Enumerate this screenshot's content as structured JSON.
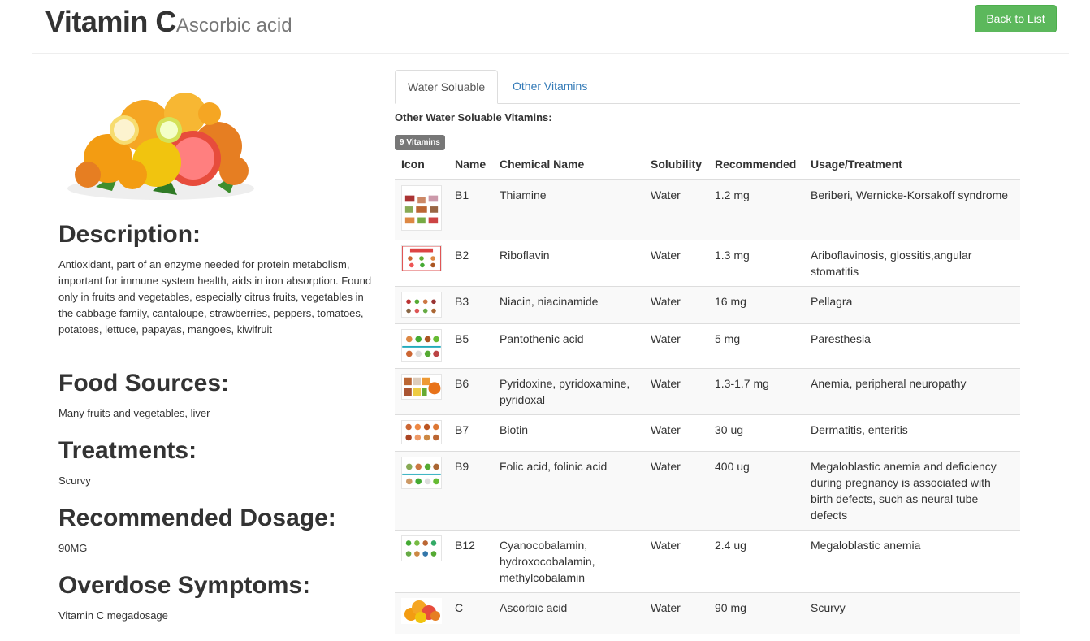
{
  "header": {
    "title": "Vitamin C",
    "subtitle": "Ascorbic acid",
    "back_label": "Back to List"
  },
  "left": {
    "description_heading": "Description:",
    "description": "Antioxidant, part of an enzyme needed for protein metabolism, important for immune system health, aids in iron absorption. Found only in fruits and vegetables, especially citrus fruits, vegetables in the cabbage family, cantaloupe, strawberries, peppers, tomatoes, potatoes, lettuce, papayas, mangoes, kiwifruit",
    "food_heading": "Food Sources:",
    "food": "Many fruits and vegetables, liver",
    "treatments_heading": "Treatments:",
    "treatments": "Scurvy",
    "dosage_heading": "Recommended Dosage:",
    "dosage": "90MG",
    "overdose_heading": "Overdose Symptoms:",
    "overdose": "Vitamin C megadosage"
  },
  "tabs": [
    "Water Soluable",
    "Other Vitamins"
  ],
  "table": {
    "subheading": "Other Water Soluable Vitamins:",
    "badge": "9 Vitamins",
    "headers": [
      "Icon",
      "Name",
      "Chemical Name",
      "Solubility",
      "Recommended",
      "Usage/Treatment"
    ],
    "rows": [
      {
        "name": "B1",
        "chemical": "Thiamine",
        "solubility": "Water",
        "recommended": "1.2 mg",
        "usage": "Beriberi, Wernicke-Korsakoff syndrome"
      },
      {
        "name": "B2",
        "chemical": "Riboflavin",
        "solubility": "Water",
        "recommended": "1.3 mg",
        "usage": "Ariboflavinosis, glossitis,angular stomatitis"
      },
      {
        "name": "B3",
        "chemical": "Niacin, niacinamide",
        "solubility": "Water",
        "recommended": "16 mg",
        "usage": "Pellagra"
      },
      {
        "name": "B5",
        "chemical": "Pantothenic acid",
        "solubility": "Water",
        "recommended": "5 mg",
        "usage": "Paresthesia"
      },
      {
        "name": "B6",
        "chemical": "Pyridoxine, pyridoxamine, pyridoxal",
        "solubility": "Water",
        "recommended": "1.3-1.7 mg",
        "usage": "Anemia, peripheral neuropathy"
      },
      {
        "name": "B7",
        "chemical": "Biotin",
        "solubility": "Water",
        "recommended": "30 ug",
        "usage": "Dermatitis, enteritis"
      },
      {
        "name": "B9",
        "chemical": "Folic acid, folinic acid",
        "solubility": "Water",
        "recommended": "400 ug",
        "usage": "Megaloblastic anemia and deficiency during pregnancy is associated with birth defects, such as neural tube defects"
      },
      {
        "name": "B12",
        "chemical": "Cyanocobalamin, hydroxocobalamin, methylcobalamin",
        "solubility": "Water",
        "recommended": "2.4 ug",
        "usage": "Megaloblastic anemia"
      },
      {
        "name": "C",
        "chemical": "Ascorbic acid",
        "solubility": "Water",
        "recommended": "90 mg",
        "usage": "Scurvy"
      }
    ]
  },
  "colors": {
    "success": "#5cb85c",
    "link": "#337ab7",
    "badge": "#777777"
  }
}
